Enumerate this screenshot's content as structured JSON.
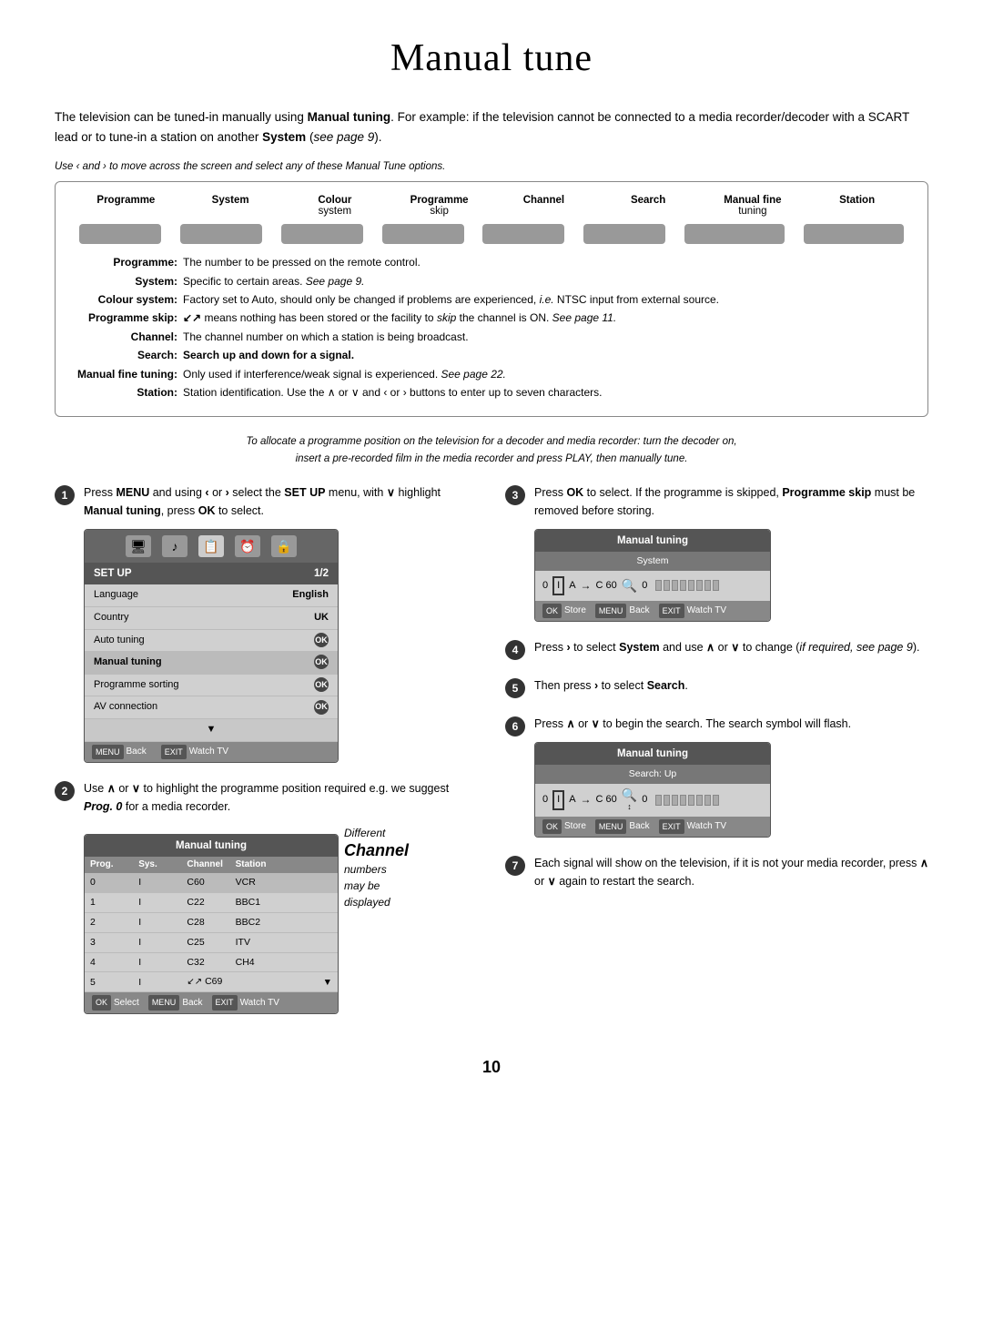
{
  "page": {
    "title": "Manual tune",
    "page_number": "10"
  },
  "intro": {
    "paragraph": "The television can be tuned-in manually using Manual tuning. For example: if the television cannot be connected to a media recorder/decoder with a SCART lead or to tune-in a station on another System (see page 9).",
    "instruction": "Use ‹ and › to move across the screen and select any of these Manual Tune options."
  },
  "menu_columns": [
    {
      "label": "Programme",
      "sub": ""
    },
    {
      "label": "System",
      "sub": ""
    },
    {
      "label": "Colour",
      "sub": "system"
    },
    {
      "label": "Programme",
      "sub": "skip"
    },
    {
      "label": "Channel",
      "sub": ""
    },
    {
      "label": "Search",
      "sub": ""
    },
    {
      "label": "Manual fine",
      "sub": "tuning"
    },
    {
      "label": "Station",
      "sub": ""
    }
  ],
  "descriptions": [
    {
      "label": "Programme:",
      "text": "The number to be pressed on the remote control."
    },
    {
      "label": "System:",
      "text": "Specific to certain areas. See page 9."
    },
    {
      "label": "Colour system:",
      "text": "Factory set to Auto, should only be changed if problems are experienced, i.e. NTSC input from external source."
    },
    {
      "label": "Programme skip:",
      "text": "means nothing has been stored or the facility to skip the channel is ON. See page 11."
    },
    {
      "label": "Channel:",
      "text": "The channel number on which a station is being broadcast."
    },
    {
      "label": "Search:",
      "text": "Search up and down for a signal."
    },
    {
      "label": "Manual fine tuning:",
      "text": "Only used if interference/weak signal is experienced. See page 22."
    },
    {
      "label": "Station:",
      "text": "Station identification. Use the ∧ or ∨ and ‹ or › buttons to enter up to seven characters."
    }
  ],
  "italic_note": "To allocate a programme position on the television for a decoder and media recorder: turn the decoder on,\ninsert a pre-recorded film in the media recorder and press PLAY, then manually tune.",
  "steps": [
    {
      "number": "1",
      "text": "Press MENU and using ‹ or › select the SET UP menu, with ∨ highlight Manual tuning, press OK to select."
    },
    {
      "number": "2",
      "text": "Use ∧ or ∨ to highlight the programme position required e.g. we suggest Prog. 0 for a media recorder."
    },
    {
      "number": "3",
      "text": "Press OK to select. If the programme is skipped, Programme skip must be removed before storing."
    },
    {
      "number": "4",
      "text": "Press › to select System and use ∧ or ∨ to change (if required, see page 9)."
    },
    {
      "number": "5",
      "text": "Then press › to select Search."
    },
    {
      "number": "6",
      "text": "Press ∧ or ∨ to begin the search. The search symbol will flash."
    },
    {
      "number": "7",
      "text": "Each signal will show on the television, if it is not your media recorder, press ∧ or ∨ again to restart the search."
    }
  ],
  "setup_screen": {
    "title": "SET UP",
    "page": "1/2",
    "rows": [
      {
        "label": "Language",
        "value": "English"
      },
      {
        "label": "Country",
        "value": "UK"
      },
      {
        "label": "Auto tuning",
        "value": "OK"
      },
      {
        "label": "Manual tuning",
        "value": "OK"
      },
      {
        "label": "Programme sorting",
        "value": "OK"
      },
      {
        "label": "AV connection",
        "value": "OK"
      }
    ],
    "footer": [
      {
        "key": "MENU",
        "label": "Back"
      },
      {
        "key": "EXIT",
        "label": "Watch TV"
      }
    ]
  },
  "tuning_table": {
    "title": "Manual tuning",
    "headers": [
      "Prog.",
      "Sys.",
      "Channel",
      "Station"
    ],
    "rows": [
      {
        "prog": "0",
        "sys": "I",
        "channel": "C60",
        "station": "VCR"
      },
      {
        "prog": "1",
        "sys": "I",
        "channel": "C22",
        "station": "BBC1"
      },
      {
        "prog": "2",
        "sys": "I",
        "channel": "C28",
        "station": "BBC2"
      },
      {
        "prog": "3",
        "sys": "I",
        "channel": "C25",
        "station": "ITV"
      },
      {
        "prog": "4",
        "sys": "I",
        "channel": "C32",
        "station": "CH4"
      },
      {
        "prog": "5",
        "sys": "I",
        "channel": "C69",
        "station": ""
      }
    ],
    "footer": [
      {
        "key": "OK",
        "label": "Select"
      },
      {
        "key": "MENU",
        "label": "Back"
      },
      {
        "key": "EXIT",
        "label": "Watch TV"
      }
    ],
    "annotation": {
      "line1": "Different",
      "line2": "Channel",
      "line3": "numbers",
      "line4": "may be",
      "line5": "displayed"
    }
  },
  "signal_screen1": {
    "title": "Manual tuning",
    "subtitle": "System",
    "values": "0  I  A  →  C 60  🔍  0",
    "footer": [
      {
        "key": "OK",
        "label": "Store"
      },
      {
        "key": "MENU",
        "label": "Back"
      },
      {
        "key": "EXIT",
        "label": "Watch TV"
      }
    ]
  },
  "signal_screen2": {
    "title": "Manual tuning",
    "subtitle": "Search: Up",
    "footer": [
      {
        "key": "OK",
        "label": "Store"
      },
      {
        "key": "MENU",
        "label": "Back"
      },
      {
        "key": "EXIT",
        "label": "Watch TV"
      }
    ]
  }
}
